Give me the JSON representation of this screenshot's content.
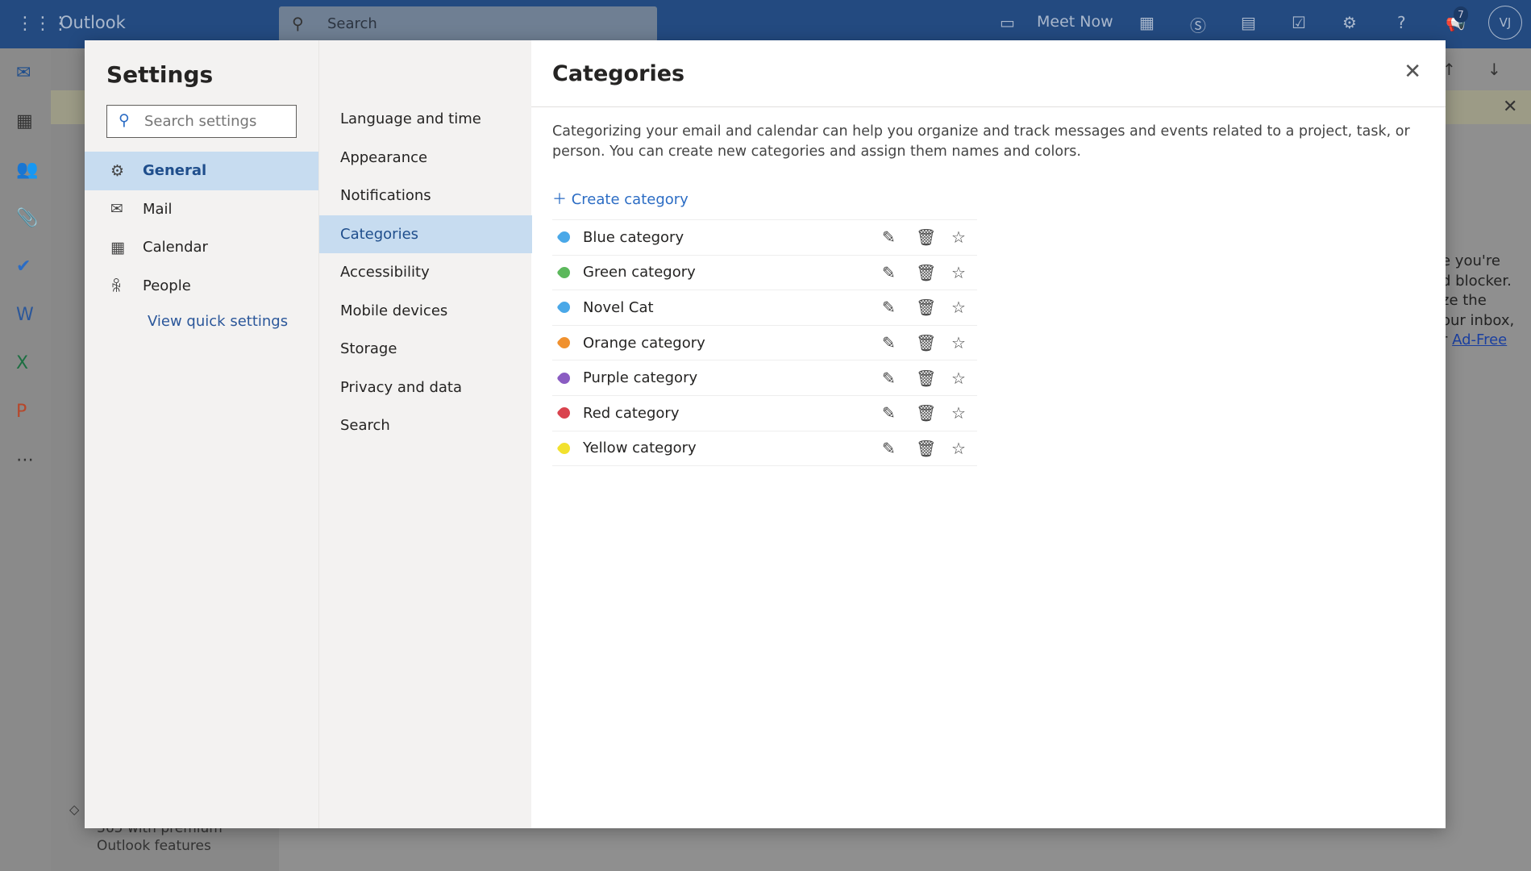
{
  "topbar": {
    "app_name": "Outlook",
    "search_placeholder": "Search",
    "meet_now": "Meet Now",
    "notification_count": "7",
    "avatar_initials": "VJ"
  },
  "background": {
    "ad_text": "e you're\nd blocker.\nze the\nour inbox,\nr ",
    "ad_link": "Ad-Free",
    "promo_line1": "365 with premium",
    "promo_line2": "Outlook features"
  },
  "settings": {
    "title": "Settings",
    "search_placeholder": "Search settings",
    "nav": [
      {
        "label": "General",
        "icon": "gear-icon",
        "selected": true
      },
      {
        "label": "Mail",
        "icon": "mail-icon"
      },
      {
        "label": "Calendar",
        "icon": "calendar-icon"
      },
      {
        "label": "People",
        "icon": "people-icon"
      }
    ],
    "quick_settings": "View quick settings",
    "subnav": [
      {
        "label": "Language and time"
      },
      {
        "label": "Appearance"
      },
      {
        "label": "Notifications"
      },
      {
        "label": "Categories",
        "selected": true
      },
      {
        "label": "Accessibility"
      },
      {
        "label": "Mobile devices"
      },
      {
        "label": "Storage"
      },
      {
        "label": "Privacy and data"
      },
      {
        "label": "Search"
      }
    ]
  },
  "categories": {
    "title": "Categories",
    "description": "Categorizing your email and calendar can help you organize and track messages and events related to a project, task, or person. You can create new categories and assign them names and colors.",
    "create_label": "Create category",
    "items": [
      {
        "name": "Blue category",
        "color": "#4aa8e8"
      },
      {
        "name": "Green category",
        "color": "#5cb85c"
      },
      {
        "name": "Novel Cat",
        "color": "#4aa8e8"
      },
      {
        "name": "Orange category",
        "color": "#f0912e"
      },
      {
        "name": "Purple category",
        "color": "#8a5cc2"
      },
      {
        "name": "Red category",
        "color": "#d9434e"
      },
      {
        "name": "Yellow category",
        "color": "#f2e12e"
      }
    ]
  }
}
